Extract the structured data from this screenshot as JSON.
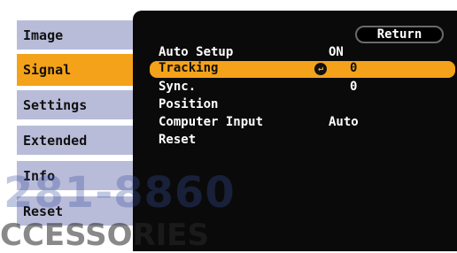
{
  "sidebar": {
    "items": [
      {
        "label": "Image"
      },
      {
        "label": "Signal"
      },
      {
        "label": "Settings"
      },
      {
        "label": "Extended"
      },
      {
        "label": "Info"
      },
      {
        "label": "Reset"
      }
    ],
    "selected": "Signal"
  },
  "panel": {
    "return_label": "Return",
    "rows": [
      {
        "label": "Auto Setup",
        "value": "ON"
      },
      {
        "label": "Tracking",
        "value": "0"
      },
      {
        "label": "Sync.",
        "value": "0"
      },
      {
        "label": "Position",
        "value": ""
      },
      {
        "label": "Computer Input",
        "value": "Auto"
      },
      {
        "label": "Reset",
        "value": ""
      }
    ],
    "highlighted_row": "Tracking"
  },
  "watermark": {
    "number": "281-8860",
    "text": "CCESSORIES"
  },
  "colors": {
    "highlight": "#f4a21a",
    "menu_item": "#b9bcd9",
    "panel_bg": "#0a0a0a"
  }
}
